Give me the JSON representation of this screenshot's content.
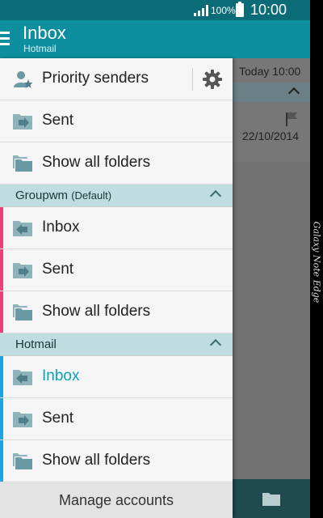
{
  "status_bar": {
    "battery": "100%",
    "time": "10:00"
  },
  "app_bar": {
    "title": "Inbox",
    "subtitle": "Hotmail"
  },
  "background_list": {
    "time": "Today 10:00",
    "date": "22/10/2014"
  },
  "drawer": {
    "priority_senders": "Priority senders",
    "top_items": [
      {
        "label": "Sent",
        "icon": "sent-folder-icon"
      },
      {
        "label": "Show all folders",
        "icon": "folders-icon"
      }
    ],
    "accounts": [
      {
        "name": "Groupwm",
        "suffix": "(Default)",
        "color": "#e8407a",
        "items": [
          {
            "label": "Inbox",
            "icon": "inbox-icon"
          },
          {
            "label": "Sent",
            "icon": "sent-folder-icon"
          },
          {
            "label": "Show all folders",
            "icon": "folders-icon"
          }
        ]
      },
      {
        "name": "Hotmail",
        "suffix": "",
        "color": "#1fa3e0",
        "items": [
          {
            "label": "Inbox",
            "icon": "inbox-icon",
            "active": true
          },
          {
            "label": "Sent",
            "icon": "sent-folder-icon"
          },
          {
            "label": "Show all folders",
            "icon": "folders-icon"
          }
        ]
      }
    ],
    "manage_accounts": "Manage accounts"
  },
  "device": {
    "edge_label": "Galaxy Note Edge"
  },
  "colors": {
    "status_bar": "#0b6c77",
    "app_bar": "#0e8fa0",
    "section_header": "#bfdde1",
    "active_text": "#0aa2b6",
    "icon": "#6a9aa4"
  }
}
